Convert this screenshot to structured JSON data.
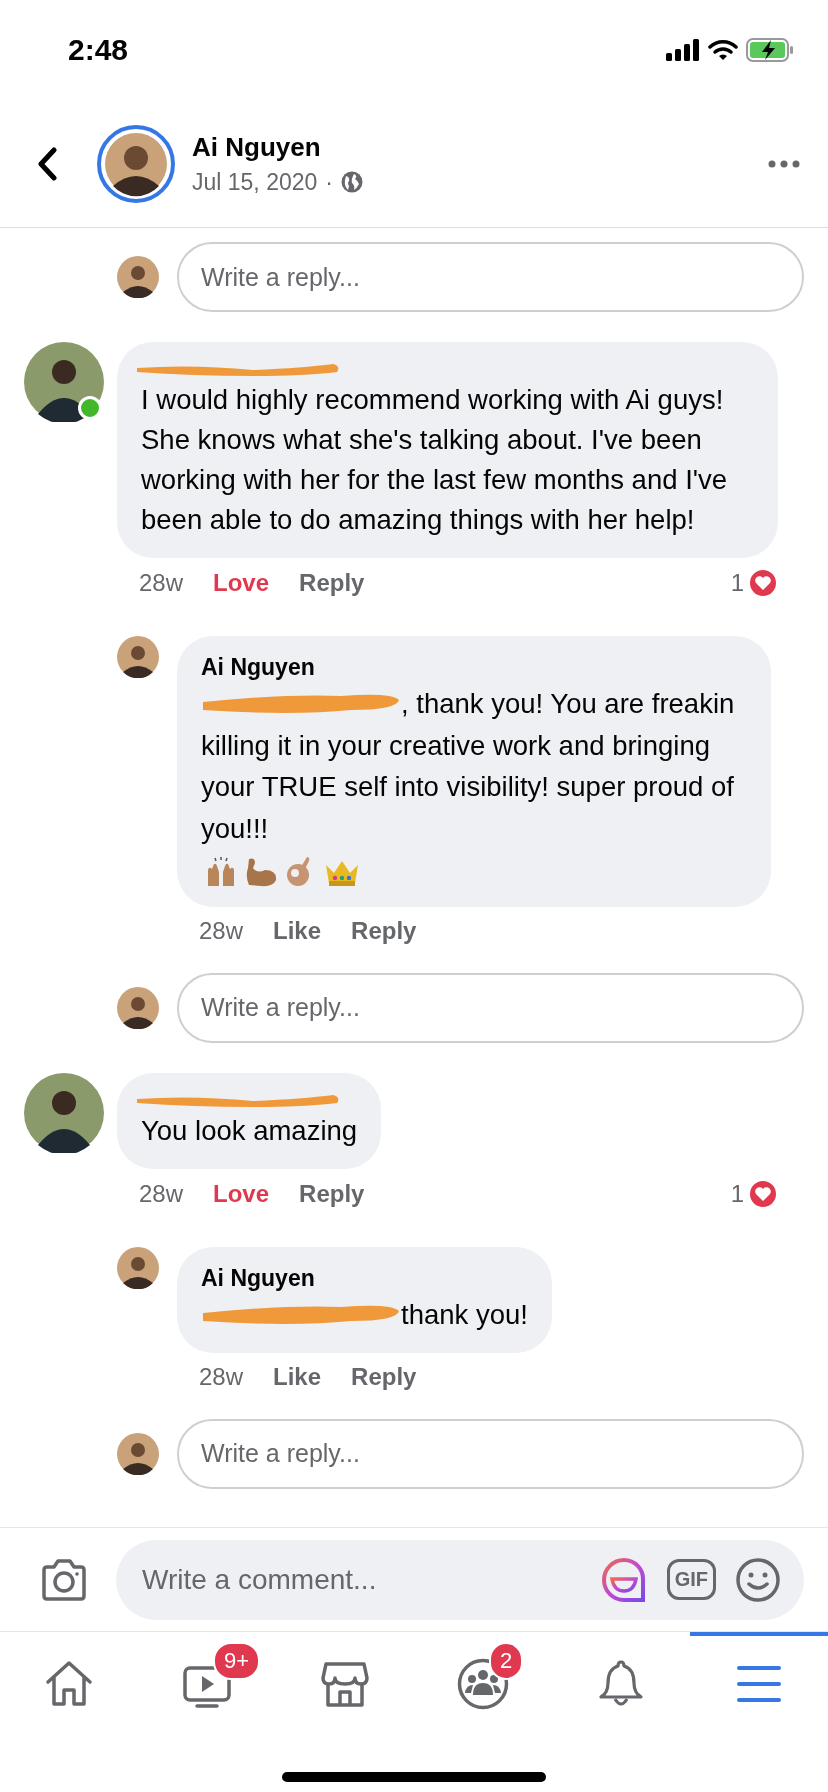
{
  "status_bar": {
    "time": "2:48"
  },
  "header": {
    "author": "Ai Nguyen",
    "date": "Jul 15, 2020",
    "separator": "·"
  },
  "thread": [
    {
      "kind": "reply_box",
      "placeholder": "Write a reply..."
    },
    {
      "kind": "comment",
      "author_redacted": true,
      "online": true,
      "text": "I would highly recommend working with Ai guys! She knows what she's talking about. I've been working with her for the last few months and I've been able to do amazing things with her help!",
      "time": "28w",
      "actions": [
        {
          "label": "Love",
          "active": true
        },
        {
          "label": "Reply",
          "active": false
        }
      ],
      "reaction_count": "1",
      "children": [
        {
          "kind": "comment",
          "author": "Ai Nguyen",
          "mention_redacted": true,
          "text": ", thank you!   You are freakin killing it in your creative work and bringing your TRUE self into visibility!   super proud of you!!!",
          "emoji_trailer": true,
          "time": "28w",
          "actions": [
            {
              "label": "Like",
              "active": false
            },
            {
              "label": "Reply",
              "active": false
            }
          ]
        },
        {
          "kind": "reply_box",
          "placeholder": "Write a reply..."
        }
      ]
    },
    {
      "kind": "comment",
      "author_redacted": true,
      "online": false,
      "text": "You look amazing",
      "time": "28w",
      "actions": [
        {
          "label": "Love",
          "active": true
        },
        {
          "label": "Reply",
          "active": false
        }
      ],
      "reaction_count": "1",
      "children": [
        {
          "kind": "comment",
          "author": "Ai Nguyen",
          "mention_redacted": true,
          "text": "thank you!",
          "time": "28w",
          "actions": [
            {
              "label": "Like",
              "active": false
            },
            {
              "label": "Reply",
              "active": false
            }
          ]
        },
        {
          "kind": "reply_box",
          "placeholder": "Write a reply..."
        }
      ]
    }
  ],
  "composer": {
    "placeholder": "Write a comment...",
    "gif_label": "GIF"
  },
  "nav": [
    {
      "kind": "home",
      "selected": false
    },
    {
      "kind": "video",
      "badge": "9+",
      "selected": false
    },
    {
      "kind": "marketplace",
      "selected": false
    },
    {
      "kind": "groups",
      "badge": "2",
      "selected": false
    },
    {
      "kind": "notifications",
      "selected": false
    },
    {
      "kind": "menu",
      "selected": true
    }
  ]
}
